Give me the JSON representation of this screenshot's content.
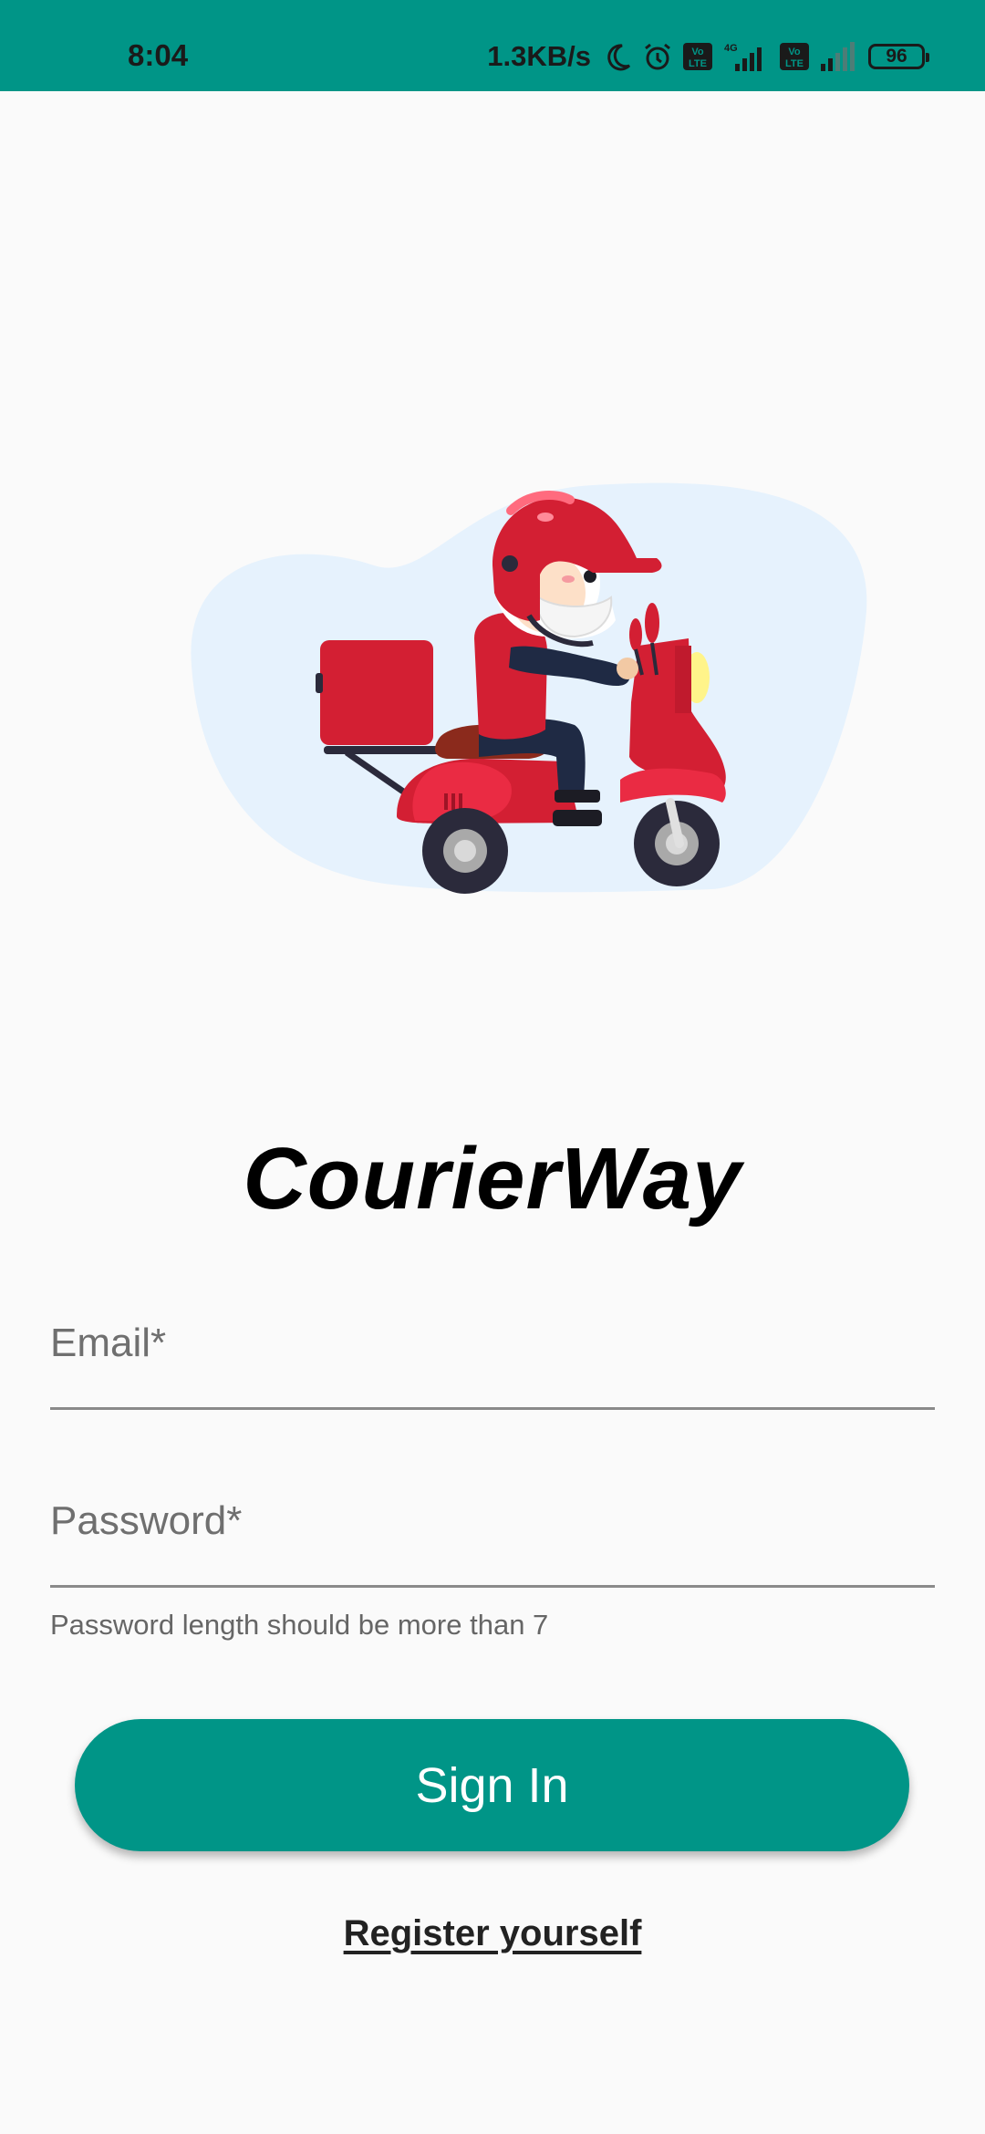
{
  "status_bar": {
    "time": "8:04",
    "network_speed": "1.3KB/s",
    "network_type": "4G",
    "volte_label": "Vo LTE",
    "battery_level": "96",
    "icons": [
      "moon-icon",
      "alarm-icon",
      "volte-icon",
      "signal-icon",
      "battery-icon"
    ]
  },
  "app": {
    "title": "CourierWay",
    "brand_color": "#009587"
  },
  "form": {
    "email_label": "Email*",
    "password_label": "Password*",
    "password_helper": "Password length should be more than 7"
  },
  "actions": {
    "sign_in_label": "Sign In",
    "register_label": "Register yourself"
  }
}
